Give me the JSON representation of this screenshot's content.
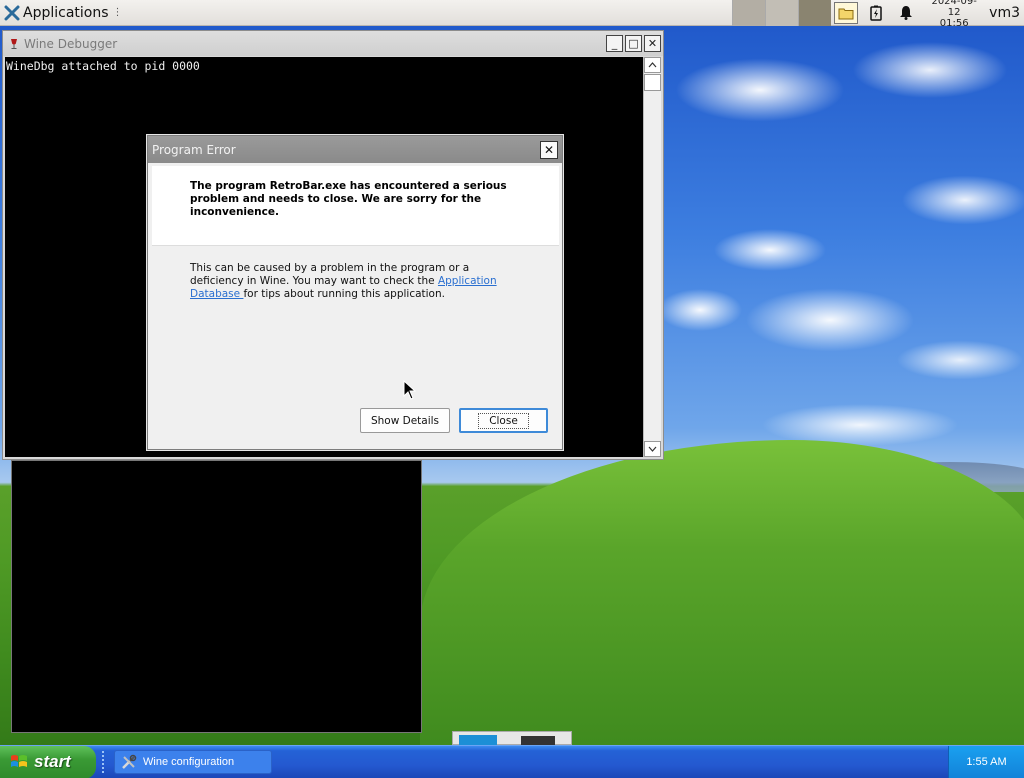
{
  "top_panel": {
    "app_menu_label": "Applications",
    "app_menu_dots": "⋮",
    "clock_date": "2024-09-12",
    "clock_time": "01:56",
    "user": "vm3",
    "icons": [
      "x-logo-icon",
      "folder-icon",
      "battery-icon",
      "bell-icon"
    ]
  },
  "debugger_window": {
    "title": "Wine Debugger",
    "console_line": "WineDbg attached to pid 0000",
    "buttons": {
      "minimize": "_",
      "maximize": "□",
      "close": "✕"
    }
  },
  "error_dialog": {
    "title": "Program Error",
    "main_message": "The program RetroBar.exe has encountered a serious problem and needs to close. We are sorry for the inconvenience.",
    "detail_prefix": "This can be caused by a problem in the program or a deficiency in Wine. You may want to check the ",
    "detail_link": "Application Database ",
    "detail_suffix": " for tips about running this application.",
    "show_details_label": "Show Details",
    "close_label": "Close",
    "close_icon": "✕"
  },
  "taskbar": {
    "start_label": "start",
    "task_items": [
      {
        "label": "Wine configuration",
        "icon": "tools-icon"
      }
    ],
    "tray_time": "1:55 AM"
  },
  "colors": {
    "taskbar_blue": "#2459d0",
    "start_green": "#3a9a35",
    "link_blue": "#2a6fd0",
    "dialog_title_gray": "#8a8a8a"
  }
}
